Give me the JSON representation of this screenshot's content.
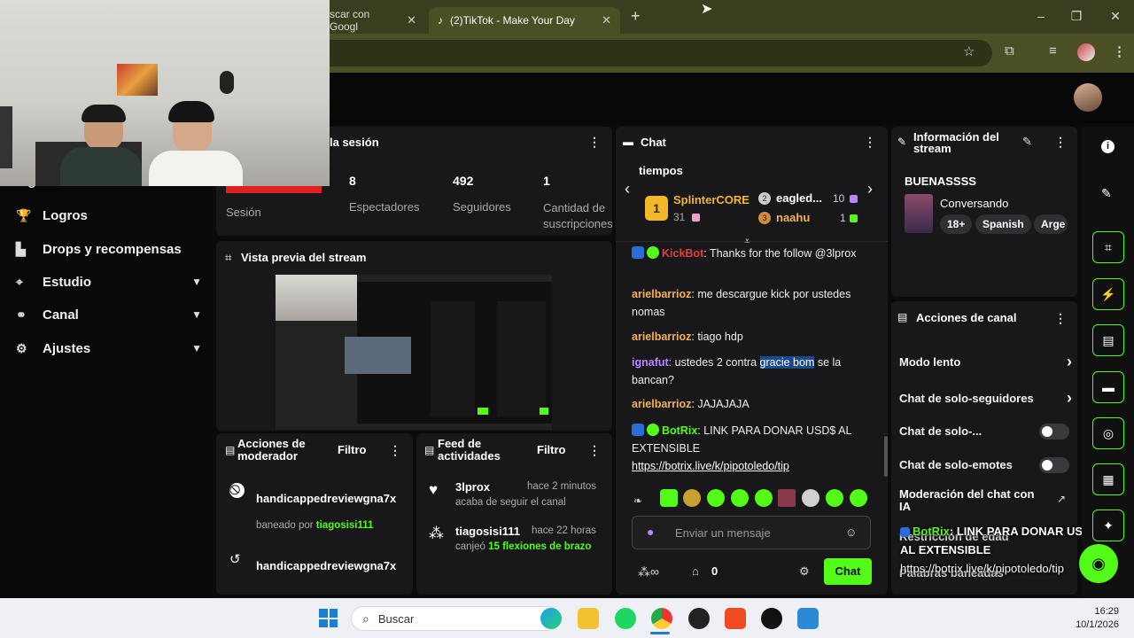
{
  "browser": {
    "tabs": [
      {
        "label": "scar con Googl"
      },
      {
        "label": "(2)TikTok - Make Your Day"
      }
    ],
    "new_tab": "+",
    "controls": {
      "minimize": "–",
      "maximize": "❐",
      "close": "✕"
    }
  },
  "sidebar": {
    "items": [
      {
        "label": "Logros",
        "icon": "trophy-icon"
      },
      {
        "label": "Drops y recompensas",
        "icon": "chart-icon"
      },
      {
        "label": "Estudio",
        "icon": "target-icon",
        "expandable": true
      },
      {
        "label": "Canal",
        "icon": "network-icon",
        "expandable": true
      },
      {
        "label": "Ajustes",
        "icon": "gear-icon",
        "expandable": true
      }
    ],
    "partial_top": "Ingresos"
  },
  "session": {
    "title": "la sesión",
    "session_label": "Sesión",
    "stats": [
      {
        "value": "8",
        "label": "Espectadores"
      },
      {
        "value": "492",
        "label": "Seguidores"
      },
      {
        "value": "1",
        "label": "Cantidad de suscripciones"
      }
    ]
  },
  "preview": {
    "title": "Vista previa del stream"
  },
  "moderator": {
    "title": "Acciones de moderador",
    "filter": "Filtro",
    "items": [
      {
        "user": "handicappedreviewgna7x",
        "detail_prefix": "baneado por",
        "detail_user": "tiagosisi111"
      },
      {
        "user": "handicappedreviewgna7x"
      }
    ]
  },
  "feed": {
    "title": "Feed de actividades",
    "filter": "Filtro",
    "items": [
      {
        "user": "3lprox",
        "time": "hace 2 minutos",
        "detail": "acaba de seguir el canal"
      },
      {
        "user": "tiagosisi111",
        "time": "hace 22 horas",
        "detail_prefix": "canjeó",
        "detail_reward": "15 flexiones de brazo"
      }
    ]
  },
  "chat": {
    "title": "Chat",
    "leaderboard_title": "tiempos",
    "leaders": [
      {
        "rank": "1",
        "name": "SplinterCORE",
        "score": "31"
      },
      {
        "name": "eagled...",
        "score": "10"
      },
      {
        "rank": "3",
        "name": "naahu",
        "score": "1"
      }
    ],
    "messages": [
      {
        "user": "KickBot",
        "text": ": Thanks for the follow @3lprox"
      },
      {
        "user": "arielbarrioz",
        "text": ": me descargue kick por ustedes nomas"
      },
      {
        "user": "arielbarrioz",
        "text": ": tiago hdp"
      },
      {
        "user": "ignafut",
        "text_before": ": ustedes 2 contra ",
        "highlight": "gracie bom",
        "text_after": " se la bancan?"
      },
      {
        "user": "arielbarrioz",
        "text": ": JAJAJAJA"
      },
      {
        "user": "BotRix",
        "text": ": LINK PARA DONAR USD$ AL EXTENSIBLE",
        "link": "https://botrix.live/k/pipotoledo/tip"
      }
    ],
    "input_placeholder": "Enviar un mensaje",
    "points": "0",
    "send_label": "Chat"
  },
  "stream_info": {
    "title": "Información del stream",
    "stream_title": "BUENASSSS",
    "category": "Conversando",
    "tags": [
      "18+",
      "Spanish",
      "Arge"
    ]
  },
  "channel_actions": {
    "title": "Acciones de canal",
    "items": [
      {
        "label": "Modo lento",
        "control": "arrow"
      },
      {
        "label": "Chat de solo-seguidores",
        "control": "arrow"
      },
      {
        "label": "Chat de solo-...",
        "control": "toggle",
        "on": false
      },
      {
        "label": "Chat de solo-emotes",
        "control": "toggle",
        "on": false
      },
      {
        "label": "Moderación del chat con IA",
        "control": "external"
      },
      {
        "label": "Restricción de edad",
        "control": "arrow"
      },
      {
        "label": "Palabras baneadas",
        "control": "arrow"
      }
    ]
  },
  "overlay": {
    "user": "BotRix",
    "line1": ": LINK PARA DONAR USD$",
    "line2": "AL EXTENSIBLE",
    "line3": "https://botrix.live/k/pipotoledo/tip"
  },
  "taskbar": {
    "search_placeholder": "Buscar",
    "time": "16:29",
    "date": "10/1/2026"
  },
  "colors": {
    "accent": "#53fc18",
    "panel": "#18181a",
    "browser": "#4a4f26"
  }
}
